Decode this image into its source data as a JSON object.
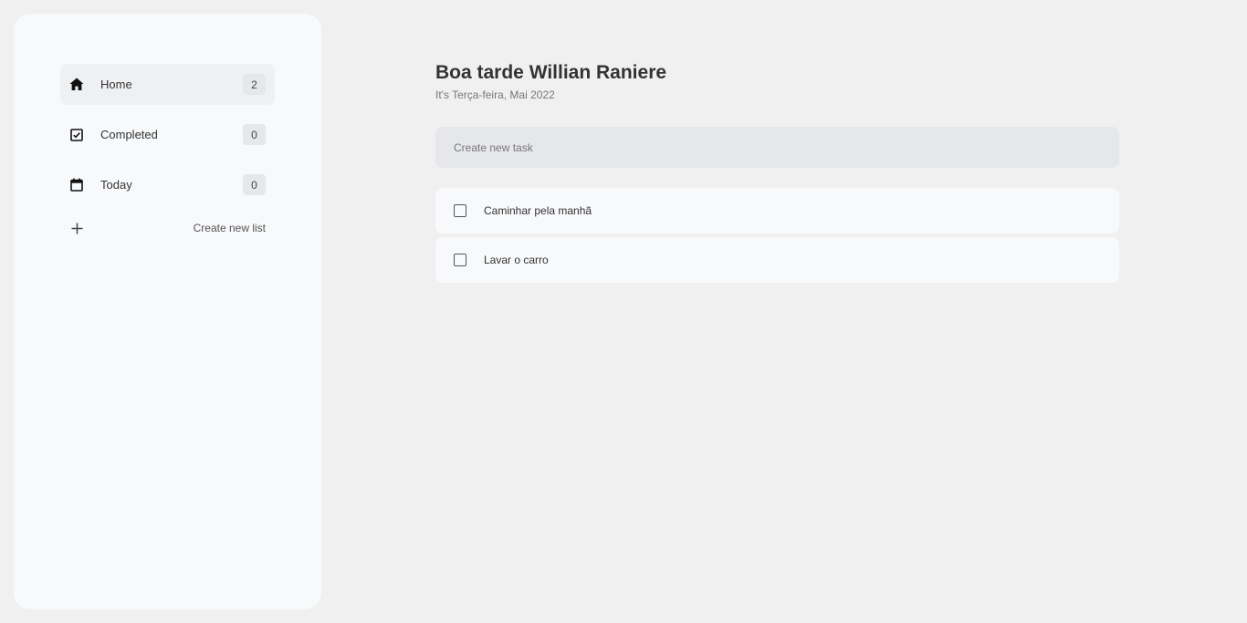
{
  "sidebar": {
    "items": [
      {
        "label": "Home",
        "count": "2",
        "icon": "home-icon"
      },
      {
        "label": "Completed",
        "count": "0",
        "icon": "checkbox-checked-icon"
      },
      {
        "label": "Today",
        "count": "0",
        "icon": "calendar-icon"
      }
    ],
    "create_list_label": "Create new list"
  },
  "main": {
    "greeting": "Boa tarde Willian Raniere",
    "date": "It's Terça-feira, Mai 2022",
    "new_task_placeholder": "Create new task",
    "tasks": [
      {
        "title": "Caminhar pela manhã",
        "done": false
      },
      {
        "title": "Lavar o carro",
        "done": false
      }
    ]
  },
  "colors": {
    "background": "#f0f0f0",
    "panel": "#f8f9fb",
    "active_item": "#eff0f2",
    "badge": "#e6e7ea"
  }
}
